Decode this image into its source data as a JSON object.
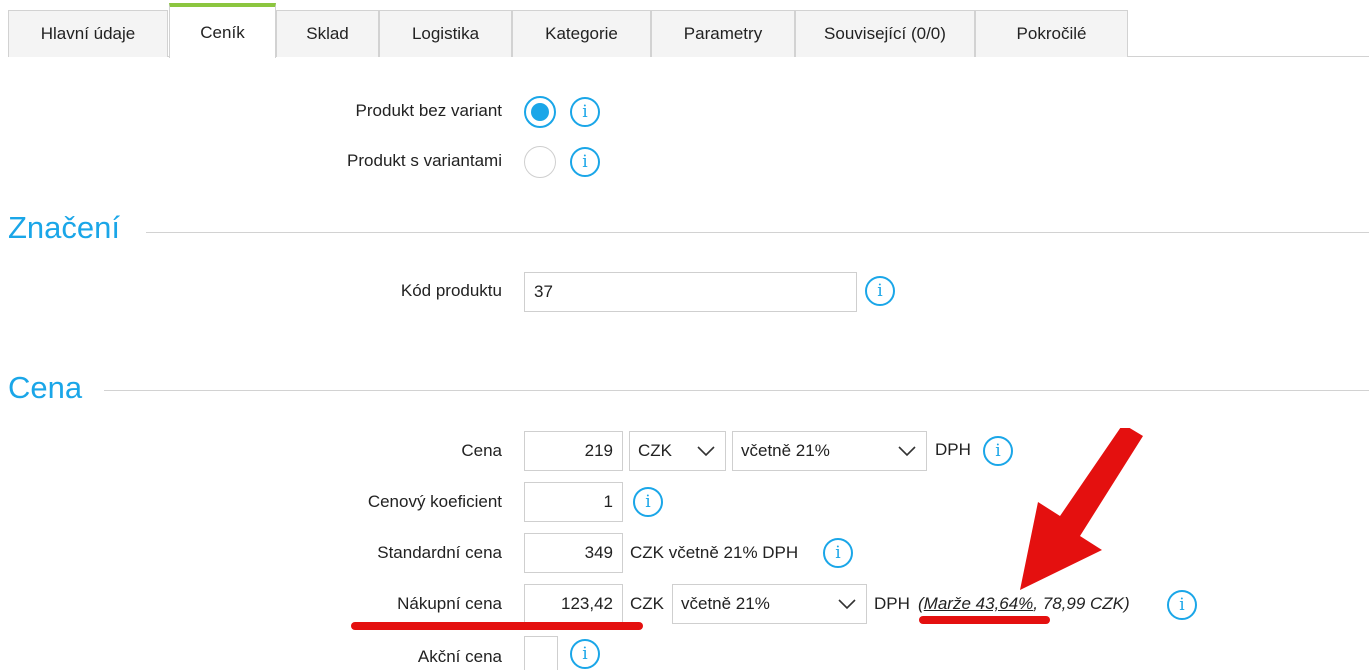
{
  "tabs": [
    {
      "label": "Hlavní údaje"
    },
    {
      "label": "Ceník"
    },
    {
      "label": "Sklad"
    },
    {
      "label": "Logistika"
    },
    {
      "label": "Kategorie"
    },
    {
      "label": "Parametry"
    },
    {
      "label": "Související (0/0)"
    },
    {
      "label": "Pokročilé"
    }
  ],
  "active_tab": "Ceník",
  "variants": {
    "without_label": "Produkt bez variant",
    "with_label": "Produkt s variantami",
    "selected": "Produkt bez variant"
  },
  "info_glyph": "i",
  "sections": {
    "marking_title": "Značení",
    "price_title": "Cena"
  },
  "product_code": {
    "label": "Kód produktu",
    "value": "37"
  },
  "price": {
    "label": "Cena",
    "value": "219",
    "currency": "CZK",
    "vat": "včetně 21%",
    "vat_suffix": "DPH"
  },
  "coefficient": {
    "label": "Cenový koeficient",
    "value": "1"
  },
  "standard_price": {
    "label": "Standardní cena",
    "value": "349",
    "suffix": "CZK včetně 21% DPH"
  },
  "purchase_price": {
    "label": "Nákupní cena",
    "value": "123,42",
    "currency": "CZK",
    "vat": "včetně 21%",
    "vat_suffix": "DPH",
    "margin_open": "(",
    "margin_text": "Marže 43,64%",
    "margin_rest": ", 78,99 CZK)"
  },
  "sale_price": {
    "label": "Akční cena",
    "value": ""
  },
  "colors": {
    "accent": "#1aa6e8",
    "active_tab": "#8cc63f",
    "annotation": "#e4100f"
  }
}
